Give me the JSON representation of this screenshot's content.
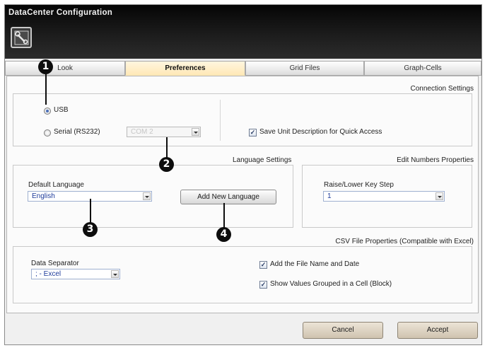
{
  "window": {
    "title": "DataCenter Configuration",
    "icon": "wrench-icon"
  },
  "tabs": [
    {
      "label": "Look",
      "active": false
    },
    {
      "label": "Preferences",
      "active": true
    },
    {
      "label": "Grid Files",
      "active": false
    },
    {
      "label": "Graph-Cells",
      "active": false
    }
  ],
  "connection": {
    "title": "Connection Settings",
    "usb_label": "USB",
    "usb_selected": true,
    "serial_label": "Serial (RS232)",
    "serial_selected": false,
    "port_value": "COM 2",
    "save_desc_label": "Save Unit Description for Quick Access",
    "save_desc_checked": true
  },
  "language": {
    "title": "Language Settings",
    "default_label": "Default Language",
    "default_value": "English",
    "add_button": "Add New Language"
  },
  "edit_numbers": {
    "title": "Edit Numbers Properties",
    "step_label": "Raise/Lower Key Step",
    "step_value": "1"
  },
  "csv": {
    "title": "CSV File Properties (Compatible with Excel)",
    "separator_label": "Data Separator",
    "separator_value": "; - Excel",
    "add_filename_label": "Add the File Name and Date",
    "add_filename_checked": true,
    "grouped_label": "Show Values Grouped in a Cell (Block)",
    "grouped_checked": true
  },
  "footer": {
    "cancel": "Cancel",
    "accept": "Accept"
  },
  "callouts": [
    "1",
    "2",
    "3",
    "4"
  ],
  "check_mark": "✓"
}
